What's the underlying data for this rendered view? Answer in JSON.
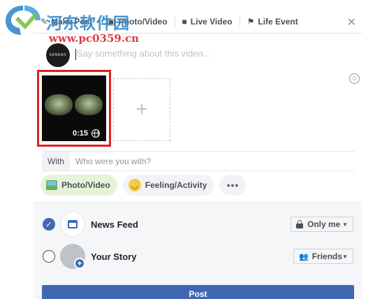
{
  "watermark": {
    "site_name_cn": "河东软件园",
    "url": "www.pc0359.cn"
  },
  "tabs": [
    {
      "label": "Make Post",
      "icon": "pencil-icon"
    },
    {
      "label": "Photo/Video",
      "icon": "camera-icon"
    },
    {
      "label": "Live Video",
      "icon": "live-video-icon"
    },
    {
      "label": "Life Event",
      "icon": "flag-icon"
    }
  ],
  "composer": {
    "avatar_text": "KANDAO",
    "placeholder": "Say something about this video..."
  },
  "video": {
    "duration": "0:15"
  },
  "with": {
    "label": "With",
    "placeholder": "Who were you with?"
  },
  "actions": [
    {
      "label": "Photo/Video",
      "icon": "photo-icon",
      "active": true
    },
    {
      "label": "Feeling/Activity",
      "icon": "smiley-icon",
      "active": false
    }
  ],
  "more_label": "•••",
  "share": {
    "news_feed": {
      "label": "News Feed",
      "checked": true,
      "audience": "Only me"
    },
    "your_story": {
      "label": "Your Story",
      "checked": false,
      "audience": "Friends"
    }
  },
  "post_button": "Post",
  "colors": {
    "brand_blue": "#4267b2",
    "highlight_red": "#e02020",
    "active_pill": "#e7f3d9"
  }
}
